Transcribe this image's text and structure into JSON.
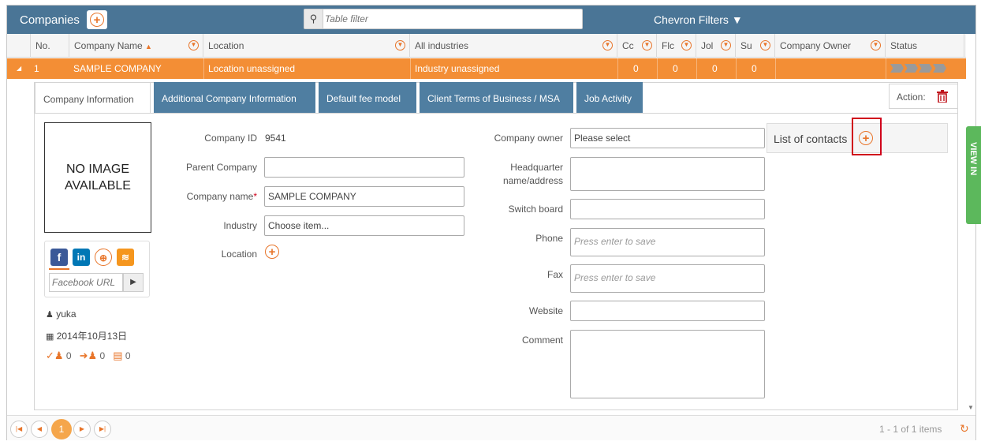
{
  "topbar": {
    "title": "Companies",
    "filter_placeholder": "Table filter",
    "chevron_filters": "Chevron Filters"
  },
  "columns": [
    "No.",
    "Company Name",
    "Location",
    "All industries",
    "Cc",
    "Flc",
    "Jol",
    "Su",
    "Company Owner",
    "Status"
  ],
  "sort_indicator": "▲",
  "selected_row": {
    "no": "1",
    "company_name": "SAMPLE COMPANY",
    "location": "Location unassigned",
    "industry": "Industry unassigned",
    "c1": "0",
    "c2": "0",
    "c3": "0",
    "c4": "0"
  },
  "tabs": [
    "Company Information",
    "Additional Company Information",
    "Default fee model",
    "Client Terms of Business / MSA",
    "Job Activity"
  ],
  "action_label": "Action:",
  "profile": {
    "no_image": "NO IMAGE AVAILABLE",
    "facebook_placeholder": "Facebook URL",
    "user": "yuka",
    "date": "2014年10月13日",
    "count1": "0",
    "count2": "0",
    "count3": "0"
  },
  "form_left": {
    "company_id_label": "Company ID",
    "company_id_value": "9541",
    "parent_company_label": "Parent Company",
    "parent_company_value": "",
    "company_name_label": "Company name",
    "required_mark": "*",
    "company_name_value": "SAMPLE COMPANY",
    "industry_label": "Industry",
    "industry_value": "Choose item...",
    "location_label": "Location"
  },
  "form_right": {
    "owner_label": "Company owner",
    "owner_value": "Please select",
    "hq_label": "Headquarter name/address",
    "switchboard_label": "Switch board",
    "phone_label": "Phone",
    "phone_placeholder": "Press enter to save",
    "fax_label": "Fax",
    "fax_placeholder": "Press enter to save",
    "website_label": "Website",
    "comment_label": "Comment"
  },
  "contacts_label": "List of contacts",
  "side_tab": "VIEW IN",
  "pager": {
    "current": "1",
    "info": "1 - 1 of 1 items"
  },
  "colors": {
    "header_blue": "#4a7596",
    "accent_orange": "#f38e35",
    "tab_blue": "#4f7ea1",
    "side_green": "#5cb85c"
  }
}
